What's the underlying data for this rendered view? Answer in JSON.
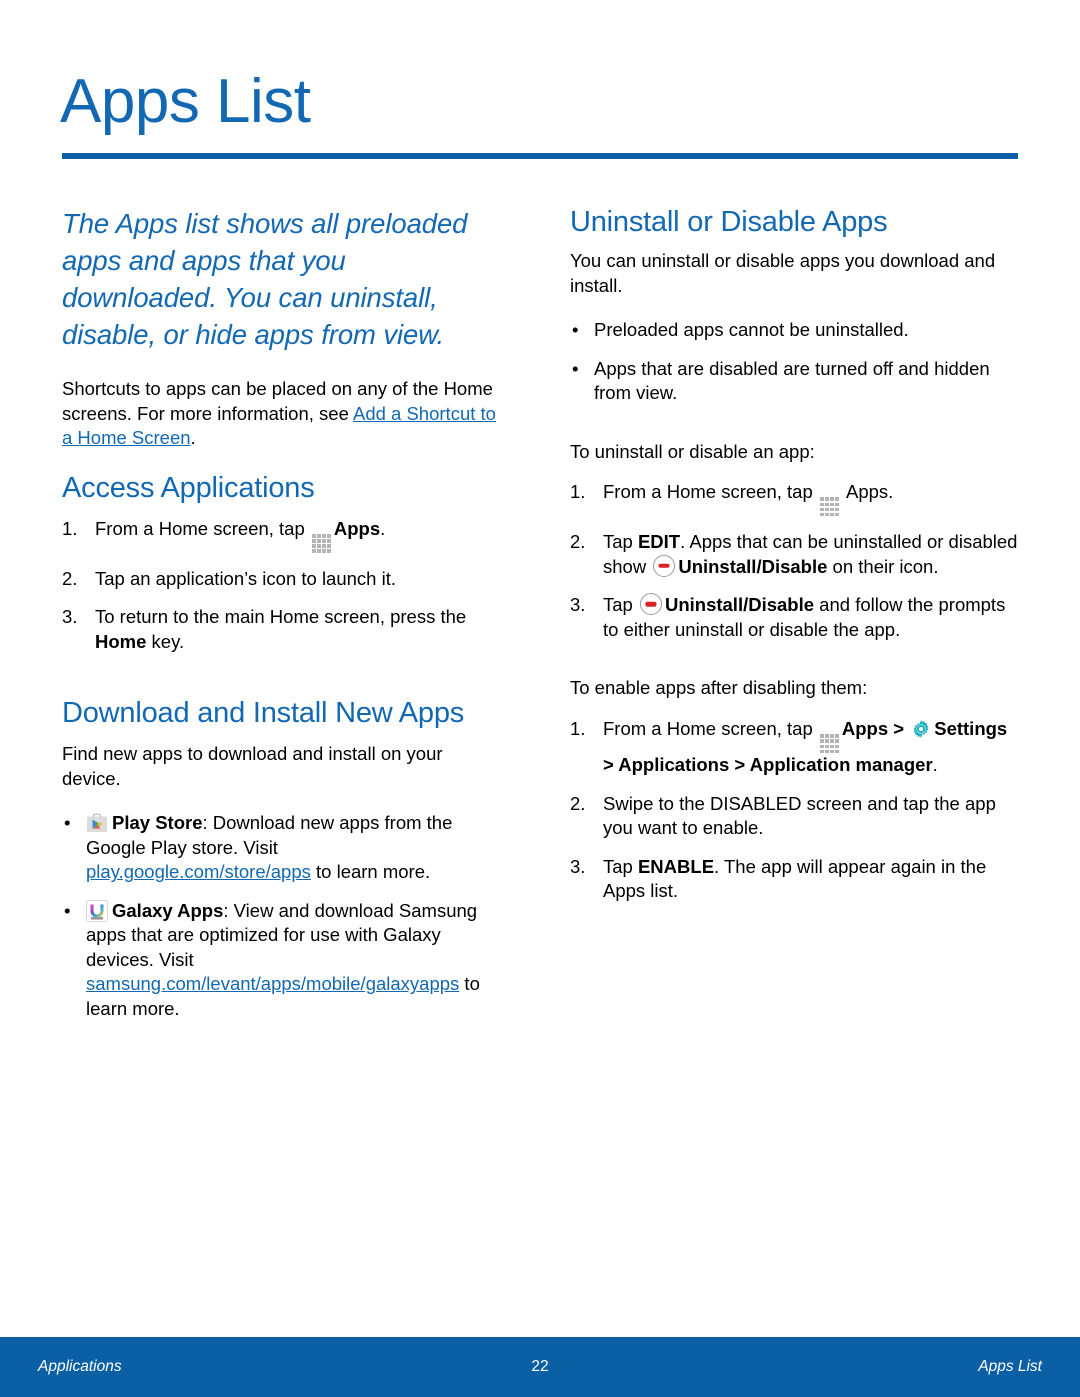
{
  "header": {
    "title": "Apps List"
  },
  "left_column": {
    "lede": "The Apps list shows all preloaded apps and apps that you downloaded. You can uninstall, disable, or hide apps from view.",
    "intro_prefix": "Shortcuts to apps can be placed on any of the Home screens. For more information, see ",
    "intro_link": "Add a Shortcut to a Home Screen",
    "intro_suffix": ".",
    "access": {
      "heading": "Access Applications",
      "steps": [
        {
          "num": "1.",
          "pre": "From a Home screen, tap ",
          "icon": "apps-grid-icon",
          "bold": "Apps",
          "post": "."
        },
        {
          "num": "2.",
          "pre": "Tap an application’s icon to launch it.",
          "icon": "",
          "bold": "",
          "post": ""
        },
        {
          "num": "3.",
          "pre": "To return to the main Home screen, press the ",
          "icon": "",
          "bold": "Home",
          "post": " key."
        }
      ]
    },
    "download": {
      "heading": "Download and Install New Apps",
      "intro": "Find new apps to download and install on your device.",
      "bullets": [
        {
          "icon": "play-store-icon",
          "bold": "Play Store",
          "text_before_link": ": Download new apps from the Google Play store. Visit ",
          "link": "play.google.com/store/apps",
          "text_after_link": " to learn more."
        },
        {
          "icon": "galaxy-apps-icon",
          "bold": "Galaxy Apps",
          "text_before_link": ": View and download Samsung apps that are optimized for use with Galaxy devices. Visit ",
          "link": "samsung.com/levant/apps/mobile/galaxyapps",
          "text_after_link": " to learn more."
        }
      ]
    }
  },
  "right_column": {
    "heading": "Uninstall or Disable Apps",
    "intro": "You can uninstall or disable apps you download and install.",
    "notes": [
      "Preloaded apps cannot be uninstalled.",
      "Apps that are disabled are turned off and hidden from view."
    ],
    "uninstall_lead": "To uninstall or disable an app:",
    "uninstall_steps": {
      "s1_num": "1.",
      "s1_pre": "From a Home screen, tap ",
      "s1_post": " Apps.",
      "s2_num": "2.",
      "s2_a": "Tap ",
      "s2_bold1": "EDIT",
      "s2_b": ". Apps that can be uninstalled or disabled show ",
      "s2_bold2": "Uninstall/Disable",
      "s2_c": " on their icon.",
      "s3_num": "3.",
      "s3_a": "Tap ",
      "s3_bold1": "Uninstall/Disable",
      "s3_b": " and follow the prompts to either uninstall or disable the app."
    },
    "enable_lead": "To enable apps after disabling them:",
    "enable_steps": {
      "e1_num": "1.",
      "e1_a": "From a Home screen, tap ",
      "e1_bold1": "Apps",
      "e1_b": " > ",
      "e1_bold2": "Settings",
      "e1_bold3": "> Applications > Application manager",
      "e1_c": ".",
      "e2_num": "2.",
      "e2_a": "Swipe to the DISABLED screen and tap the app you want to enable.",
      "e3_num": "3.",
      "e3_a": "Tap ",
      "e3_bold1": "ENABLE",
      "e3_b": ". The app will appear again in the Apps list."
    }
  },
  "footer": {
    "left": "Applications",
    "page_number": "22",
    "right": "Apps List"
  },
  "icons": {
    "apps_grid": "apps-grid-icon",
    "uninstall_disable": "uninstall-disable-icon",
    "settings_gear": "settings-gear-icon",
    "play_store": "play-store-icon",
    "galaxy_apps": "galaxy-apps-icon"
  },
  "colors": {
    "brand_blue": "#1268B3",
    "rule_blue": "#0B5FA5",
    "footer_blue": "#0B5FA5",
    "link_blue": "#1268B3",
    "icon_gray": "#B4B4B4",
    "minus_red": "#D92129",
    "gear_teal": "#21B2C4"
  },
  "bullet_glyph": "•"
}
